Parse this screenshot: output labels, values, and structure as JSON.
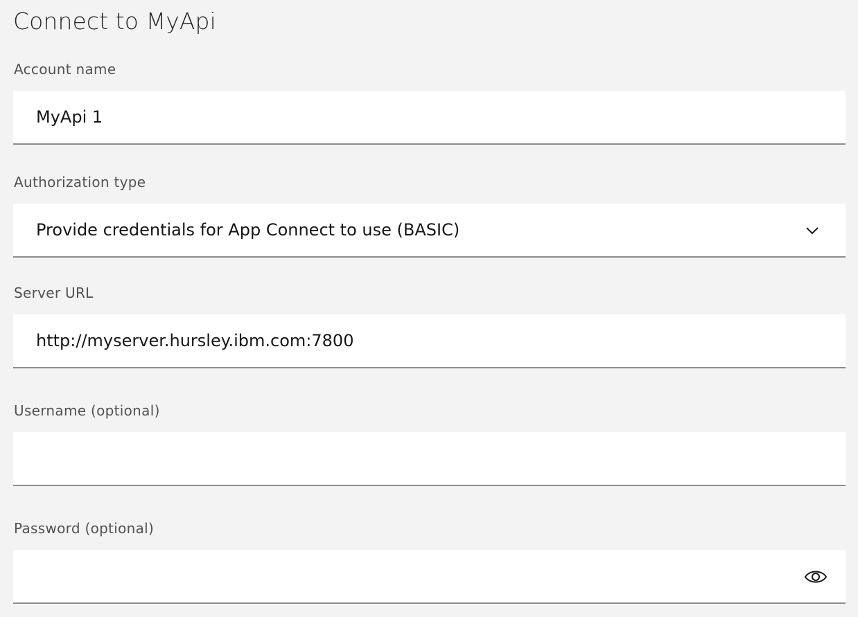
{
  "form": {
    "title": "Connect to MyApi",
    "account_name": {
      "label": "Account name",
      "value": "MyApi 1"
    },
    "authorization_type": {
      "label": "Authorization type",
      "selected": "Provide credentials for App Connect to use (BASIC)"
    },
    "server_url": {
      "label": "Server URL",
      "value": "http://myserver.hursley.ibm.com:7800"
    },
    "username": {
      "label": "Username (optional)",
      "value": ""
    },
    "password": {
      "label": "Password (optional)",
      "value": ""
    }
  },
  "icons": {
    "select_toggle": "chevron-down-icon",
    "password_visibility": "eye-icon"
  }
}
